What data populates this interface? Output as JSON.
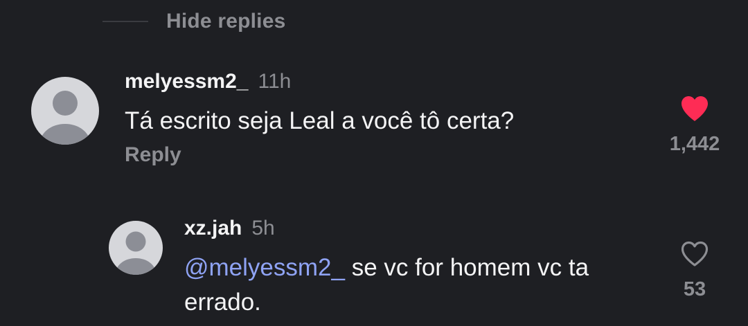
{
  "hide_replies": {
    "label": "Hide replies"
  },
  "comments": [
    {
      "username": "melyessm2_",
      "time": "11h",
      "text": "Tá escrito seja Leal a você tô certa?",
      "reply_label": "Reply",
      "like_count": "1,442",
      "liked": true,
      "like_icon": "heart-filled-icon",
      "avatar_icon": "default-avatar-icon"
    },
    {
      "username": "xz.jah",
      "time": "5h",
      "mention": "@melyessm2_",
      "text": " se vc for homem vc ta errado.",
      "like_count": "53",
      "liked": false,
      "like_icon": "heart-outline-icon",
      "avatar_icon": "default-avatar-icon"
    }
  ],
  "colors": {
    "background": "#1e1f23",
    "muted_text": "#8d8e93",
    "primary_text": "#f4f4f5",
    "mention": "#8fa3f4",
    "like_active": "#fe2c55"
  }
}
